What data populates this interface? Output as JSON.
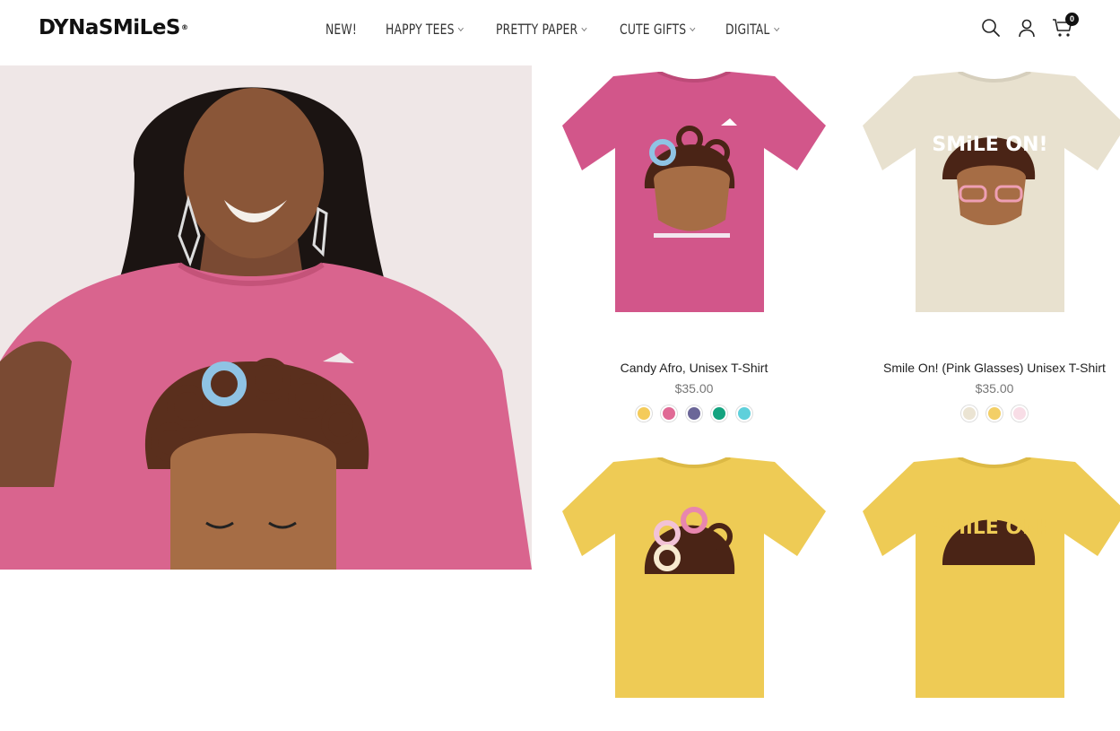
{
  "brand": {
    "name": "DYNaSMiLeS",
    "reg": "®"
  },
  "nav": {
    "items": [
      {
        "label": "NEW!",
        "has_menu": false
      },
      {
        "label": "HAPPY TEES",
        "has_menu": true
      },
      {
        "label": "PRETTY PAPER",
        "has_menu": true
      },
      {
        "label": "CUTE GIFTS",
        "has_menu": true
      },
      {
        "label": "DIGITAL",
        "has_menu": true
      }
    ]
  },
  "header_icons": [
    "search-icon",
    "account-icon",
    "cart-icon"
  ],
  "cart": {
    "count": "0"
  },
  "products": [
    {
      "title": "Candy Afro, Unisex T-Shirt",
      "price": "$35.00",
      "shirt_color": "#d2568a",
      "swatches": [
        "#f4cb5a",
        "#e06a95",
        "#6b6698",
        "#14a37f",
        "#5fd0db"
      ]
    },
    {
      "title": "Smile On! (Pink Glasses) Unisex T-Shirt",
      "price": "$35.00",
      "shirt_color": "#e8e1cf",
      "swatches": [
        "#ebe4d3",
        "#f3cf66",
        "#f8dde6"
      ]
    },
    {
      "title": "",
      "price": "",
      "shirt_color": "#eecb55",
      "swatches": []
    },
    {
      "title": "",
      "price": "",
      "shirt_color": "#eecb55",
      "swatches": []
    }
  ],
  "graphic_text": {
    "smile_on": "SMiLE ON!"
  }
}
